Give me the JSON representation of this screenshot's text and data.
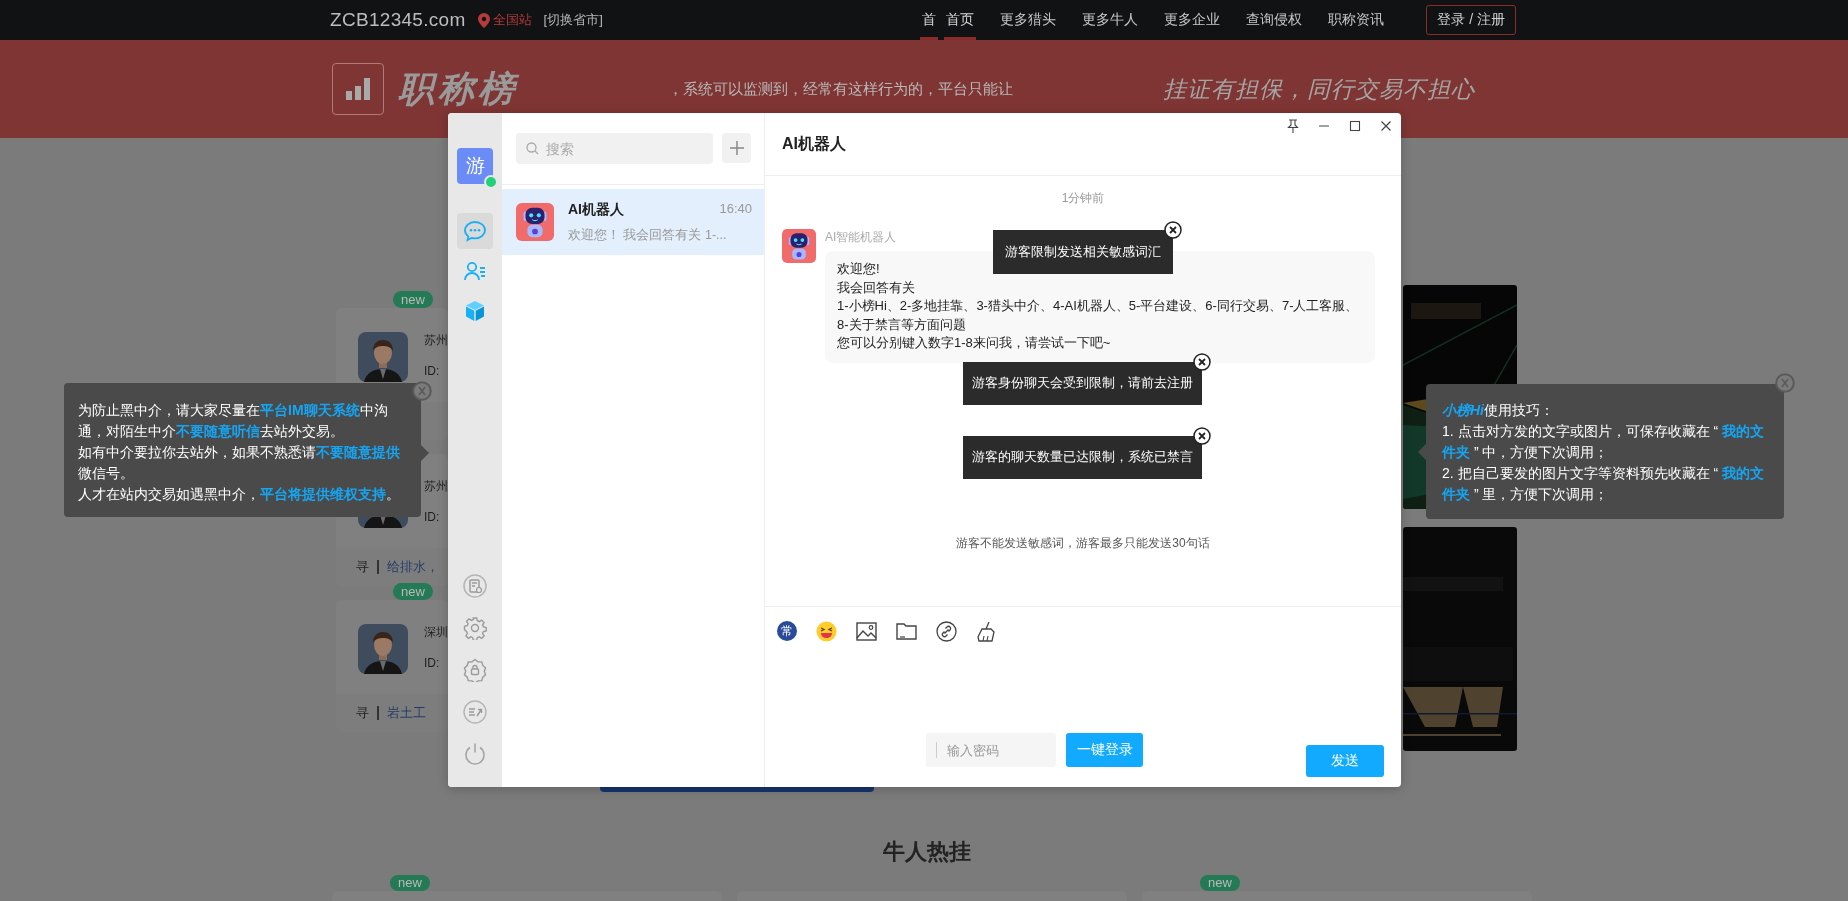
{
  "topbar": {
    "logo": "ZCB12345.com",
    "location": "全国站",
    "switch_city": "[切换省市]",
    "nav": [
      {
        "label": "首",
        "selected": true
      },
      {
        "label": "首页",
        "selected": true
      },
      {
        "label": "更多猎头",
        "selected": false
      },
      {
        "label": "更多牛人",
        "selected": false
      },
      {
        "label": "更多企业",
        "selected": false
      },
      {
        "label": "查询侵权",
        "selected": false
      },
      {
        "label": "职称资讯",
        "selected": false
      }
    ],
    "login": "登录 / 注册"
  },
  "banner": {
    "brand": "职称榜",
    "marquee": "，系统可以监测到，经常有这样行为的，平台只能让",
    "slogan": "挂证有担保，同行交易不担心"
  },
  "talent_cards": [
    {
      "badge": "new",
      "city": "苏州",
      "id": "ID:"
    },
    {
      "city": "苏州",
      "id": "ID:",
      "seek": "寻",
      "skill": "给排水，"
    },
    {
      "badge": "new",
      "city": "深圳",
      "id": "ID:",
      "seek": "寻",
      "skill": "岩土工"
    }
  ],
  "section_title": "牛人热挂",
  "bottom_cards": [
    {
      "kind": "badged",
      "badge": "new"
    },
    {
      "kind": "plain"
    },
    {
      "kind": "badged",
      "badge": "new"
    }
  ],
  "chat": {
    "rail": {
      "avatar": "游",
      "online": true,
      "items": [
        {
          "kind": "chat",
          "selected": true
        },
        {
          "kind": "contacts",
          "selected": false
        },
        {
          "kind": "box",
          "selected": false
        }
      ]
    },
    "search": {
      "placeholder": "搜索"
    },
    "conversations": [
      {
        "name": "AI机器人",
        "time": "16:40",
        "preview": "欢迎您！ 我会回答有关 1-...",
        "selected": true
      }
    ],
    "title": "AI机器人",
    "timestamp": "1分钟前",
    "message": {
      "sender": "AI智能机器人",
      "lines": [
        "欢迎您!",
        "我会回答有关",
        "1-小榜Hi、2-多地挂靠、3-猎头中介、4-AI机器人、5-平台建设、6-同行交易、7-人工客服、8-关于禁言等方面问题",
        "您可以分别键入数字1-8来问我，请尝试一下吧~"
      ]
    },
    "alerts": [
      "游客限制发送相关敏感词汇",
      "游客身份聊天会受到限制，请前去注册",
      "游客的聊天数量已达限制，系统已禁言"
    ],
    "notice": "游客不能发送敏感词，游客最多只能发送30句话",
    "quick_reply": "常",
    "password": {
      "placeholder": "输入密码"
    },
    "login_button": "一键登录",
    "send_button": "发送"
  },
  "left_tip": {
    "paragraphs": [
      "为防止黑中介，请大家尽量在**平台IM聊天系统**中沟通，对陌生中介**不要随意听信**去站外交易。",
      "如有中介要拉你去站外，如果不熟悉请**不要随意提供**微信号。",
      "人才在站内交易如遇黑中介，**平台将提供维权支持**。"
    ]
  },
  "right_tip": {
    "heading": {
      "name": "小榜Hi",
      "rest": "使用技巧："
    },
    "paragraphs": [
      "1. 点击对方发的文字或图片，可保存收藏在 “ **我的文件夹** ” 中，方便下次调用；",
      "2. 把自己要发的图片文字等资料预先收藏在 “ **我的文件夹** ” 里，方便下次调用；"
    ]
  }
}
